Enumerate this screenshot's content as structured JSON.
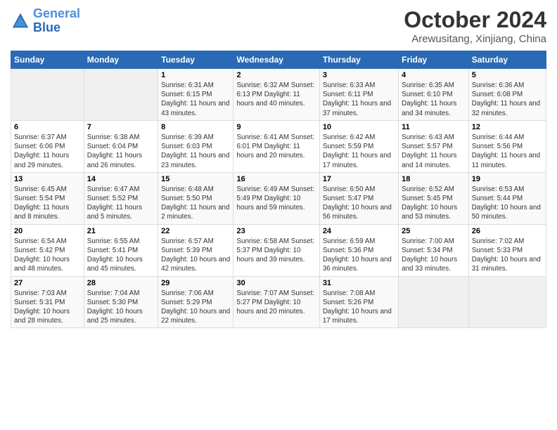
{
  "header": {
    "logo_line1": "General",
    "logo_line2": "Blue",
    "month": "October 2024",
    "location": "Arewusitang, Xinjiang, China"
  },
  "days_of_week": [
    "Sunday",
    "Monday",
    "Tuesday",
    "Wednesday",
    "Thursday",
    "Friday",
    "Saturday"
  ],
  "rows": [
    [
      {
        "day": "",
        "info": ""
      },
      {
        "day": "",
        "info": ""
      },
      {
        "day": "1",
        "info": "Sunrise: 6:31 AM\nSunset: 6:15 PM\nDaylight: 11 hours\nand 43 minutes."
      },
      {
        "day": "2",
        "info": "Sunrise: 6:32 AM\nSunset: 6:13 PM\nDaylight: 11 hours\nand 40 minutes."
      },
      {
        "day": "3",
        "info": "Sunrise: 6:33 AM\nSunset: 6:11 PM\nDaylight: 11 hours\nand 37 minutes."
      },
      {
        "day": "4",
        "info": "Sunrise: 6:35 AM\nSunset: 6:10 PM\nDaylight: 11 hours\nand 34 minutes."
      },
      {
        "day": "5",
        "info": "Sunrise: 6:36 AM\nSunset: 6:08 PM\nDaylight: 11 hours\nand 32 minutes."
      }
    ],
    [
      {
        "day": "6",
        "info": "Sunrise: 6:37 AM\nSunset: 6:06 PM\nDaylight: 11 hours\nand 29 minutes."
      },
      {
        "day": "7",
        "info": "Sunrise: 6:38 AM\nSunset: 6:04 PM\nDaylight: 11 hours\nand 26 minutes."
      },
      {
        "day": "8",
        "info": "Sunrise: 6:39 AM\nSunset: 6:03 PM\nDaylight: 11 hours\nand 23 minutes."
      },
      {
        "day": "9",
        "info": "Sunrise: 6:41 AM\nSunset: 6:01 PM\nDaylight: 11 hours\nand 20 minutes."
      },
      {
        "day": "10",
        "info": "Sunrise: 6:42 AM\nSunset: 5:59 PM\nDaylight: 11 hours\nand 17 minutes."
      },
      {
        "day": "11",
        "info": "Sunrise: 6:43 AM\nSunset: 5:57 PM\nDaylight: 11 hours\nand 14 minutes."
      },
      {
        "day": "12",
        "info": "Sunrise: 6:44 AM\nSunset: 5:56 PM\nDaylight: 11 hours\nand 11 minutes."
      }
    ],
    [
      {
        "day": "13",
        "info": "Sunrise: 6:45 AM\nSunset: 5:54 PM\nDaylight: 11 hours\nand 8 minutes."
      },
      {
        "day": "14",
        "info": "Sunrise: 6:47 AM\nSunset: 5:52 PM\nDaylight: 11 hours\nand 5 minutes."
      },
      {
        "day": "15",
        "info": "Sunrise: 6:48 AM\nSunset: 5:50 PM\nDaylight: 11 hours\nand 2 minutes."
      },
      {
        "day": "16",
        "info": "Sunrise: 6:49 AM\nSunset: 5:49 PM\nDaylight: 10 hours\nand 59 minutes."
      },
      {
        "day": "17",
        "info": "Sunrise: 6:50 AM\nSunset: 5:47 PM\nDaylight: 10 hours\nand 56 minutes."
      },
      {
        "day": "18",
        "info": "Sunrise: 6:52 AM\nSunset: 5:45 PM\nDaylight: 10 hours\nand 53 minutes."
      },
      {
        "day": "19",
        "info": "Sunrise: 6:53 AM\nSunset: 5:44 PM\nDaylight: 10 hours\nand 50 minutes."
      }
    ],
    [
      {
        "day": "20",
        "info": "Sunrise: 6:54 AM\nSunset: 5:42 PM\nDaylight: 10 hours\nand 48 minutes."
      },
      {
        "day": "21",
        "info": "Sunrise: 6:55 AM\nSunset: 5:41 PM\nDaylight: 10 hours\nand 45 minutes."
      },
      {
        "day": "22",
        "info": "Sunrise: 6:57 AM\nSunset: 5:39 PM\nDaylight: 10 hours\nand 42 minutes."
      },
      {
        "day": "23",
        "info": "Sunrise: 6:58 AM\nSunset: 5:37 PM\nDaylight: 10 hours\nand 39 minutes."
      },
      {
        "day": "24",
        "info": "Sunrise: 6:59 AM\nSunset: 5:36 PM\nDaylight: 10 hours\nand 36 minutes."
      },
      {
        "day": "25",
        "info": "Sunrise: 7:00 AM\nSunset: 5:34 PM\nDaylight: 10 hours\nand 33 minutes."
      },
      {
        "day": "26",
        "info": "Sunrise: 7:02 AM\nSunset: 5:33 PM\nDaylight: 10 hours\nand 31 minutes."
      }
    ],
    [
      {
        "day": "27",
        "info": "Sunrise: 7:03 AM\nSunset: 5:31 PM\nDaylight: 10 hours\nand 28 minutes."
      },
      {
        "day": "28",
        "info": "Sunrise: 7:04 AM\nSunset: 5:30 PM\nDaylight: 10 hours\nand 25 minutes."
      },
      {
        "day": "29",
        "info": "Sunrise: 7:06 AM\nSunset: 5:29 PM\nDaylight: 10 hours\nand 22 minutes."
      },
      {
        "day": "30",
        "info": "Sunrise: 7:07 AM\nSunset: 5:27 PM\nDaylight: 10 hours\nand 20 minutes."
      },
      {
        "day": "31",
        "info": "Sunrise: 7:08 AM\nSunset: 5:26 PM\nDaylight: 10 hours\nand 17 minutes."
      },
      {
        "day": "",
        "info": ""
      },
      {
        "day": "",
        "info": ""
      }
    ]
  ]
}
